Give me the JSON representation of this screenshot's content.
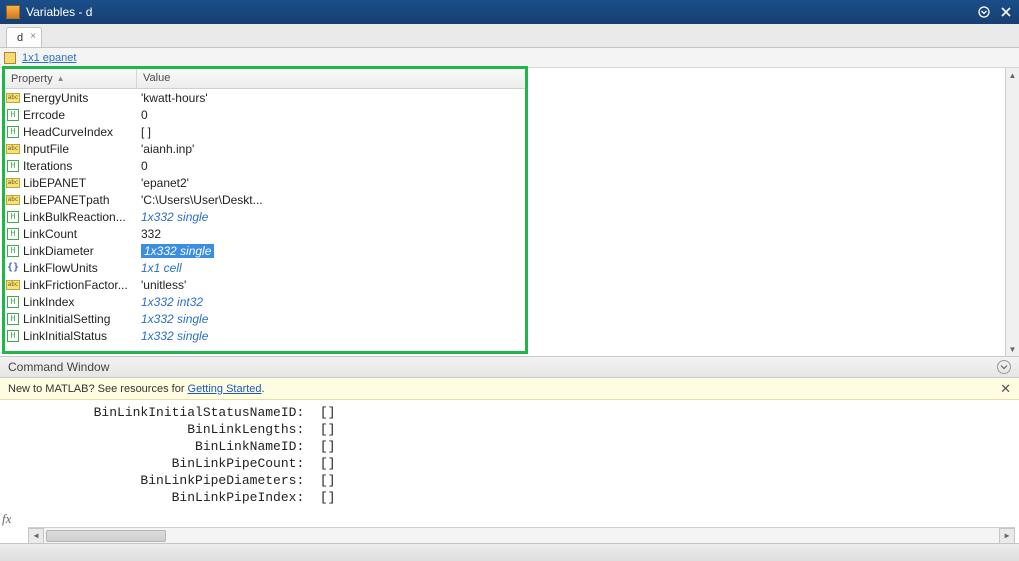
{
  "titlebar": {
    "title": "Variables - d"
  },
  "tab": {
    "label": "d"
  },
  "breadcrumb": {
    "text": "1x1 epanet"
  },
  "columns": {
    "property": "Property",
    "value": "Value"
  },
  "rows": [
    {
      "icon": "abc",
      "name": "EnergyUnits",
      "value": "'kwatt-hours'",
      "style": "plain"
    },
    {
      "icon": "H",
      "name": "Errcode",
      "value": "0",
      "style": "plain"
    },
    {
      "icon": "H",
      "name": "HeadCurveIndex",
      "value": "[ ]",
      "style": "plain"
    },
    {
      "icon": "abc",
      "name": "InputFile",
      "value": "'aianh.inp'",
      "style": "plain"
    },
    {
      "icon": "H",
      "name": "Iterations",
      "value": "0",
      "style": "plain"
    },
    {
      "icon": "abc",
      "name": "LibEPANET",
      "value": "'epanet2'",
      "style": "plain"
    },
    {
      "icon": "abc",
      "name": "LibEPANETpath",
      "value": "'C:\\Users\\User\\Deskt...",
      "style": "plain"
    },
    {
      "icon": "H",
      "name": "LinkBulkReaction...",
      "value": "1x332 single",
      "style": "link"
    },
    {
      "icon": "H",
      "name": "LinkCount",
      "value": "332",
      "style": "plain"
    },
    {
      "icon": "H",
      "name": "LinkDiameter",
      "value": "1x332 single",
      "style": "selected"
    },
    {
      "icon": "brace",
      "name": "LinkFlowUnits",
      "value": "1x1 cell",
      "style": "link"
    },
    {
      "icon": "abc",
      "name": "LinkFrictionFactor...",
      "value": "'unitless'",
      "style": "plain"
    },
    {
      "icon": "H",
      "name": "LinkIndex",
      "value": "1x332 int32",
      "style": "link"
    },
    {
      "icon": "H",
      "name": "LinkInitialSetting",
      "value": "1x332 single",
      "style": "link"
    },
    {
      "icon": "H",
      "name": "LinkInitialStatus",
      "value": "1x332 single",
      "style": "link"
    }
  ],
  "cmdwindow": {
    "title": "Command Window"
  },
  "banner": {
    "prefix": "New to MATLAB? See resources for ",
    "linktext": "Getting Started",
    "suffix": "."
  },
  "console_lines": [
    "            BinLinkInitialStatusNameID:  []",
    "                        BinLinkLengths:  []",
    "                         BinLinkNameID:  []",
    "                      BinLinkPipeCount:  []",
    "                  BinLinkPipeDiameters:  []",
    "                      BinLinkPipeIndex:  []"
  ],
  "fx_prompt": "fx"
}
